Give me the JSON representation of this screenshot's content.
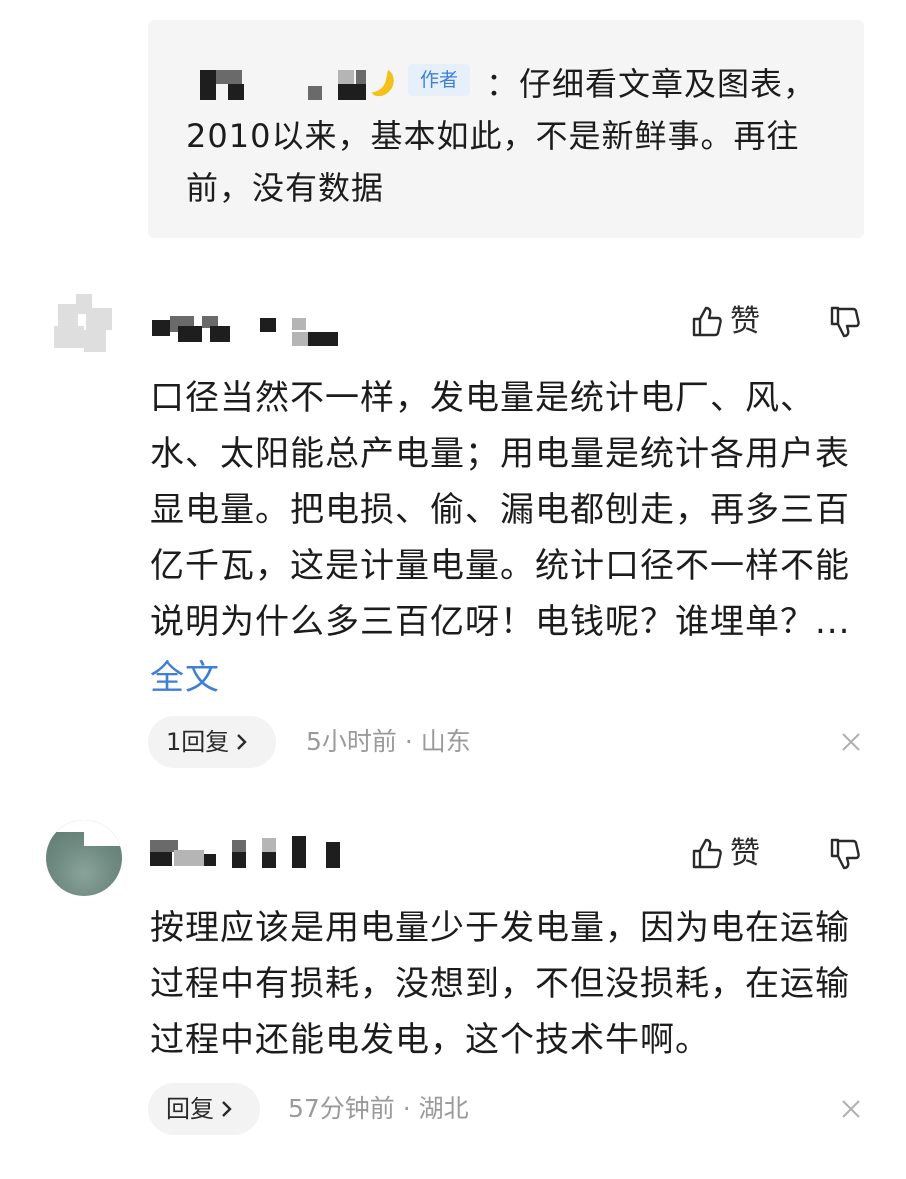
{
  "quote": {
    "author_tag": "作者",
    "text": "：仔细看文章及图表，2010以来，基本如此，不是新鲜事。再往前，没有数据"
  },
  "comments": [
    {
      "like_label": "赞",
      "body": "口径当然不一样，发电量是统计电厂、风、水、太阳能总产电量；用电量是统计各用户表显电量。把电损、偷、漏电都刨走，再多三百亿千瓦，这是计量电量。统计口径不一样不能说明为什么多三百亿呀！电钱呢？谁埋单？...",
      "more": "全文",
      "reply_label": "1回复",
      "time": "5小时前",
      "location": "山东"
    },
    {
      "like_label": "赞",
      "body": "按理应该是用电量少于发电量，因为电在运输过程中有损耗，没想到，不但没损耗，在运输过程中还能电发电，这个技术牛啊。",
      "reply_label": "回复",
      "time": "57分钟前",
      "location": "湖北"
    }
  ],
  "meta_separator": "·",
  "icons": [
    "thumbs-up-icon",
    "thumbs-down-icon",
    "chevron-right-icon",
    "close-icon"
  ],
  "colors": {
    "link": "#3f7fd6",
    "meta": "#9a9a9a",
    "quote_bg": "#f5f5f5",
    "tag_bg": "#e6f0fb"
  }
}
